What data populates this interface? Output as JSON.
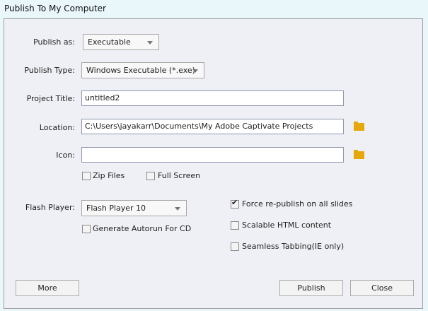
{
  "window": {
    "title": "Publish To My Computer"
  },
  "form": {
    "publish_as_label": "Publish as:",
    "publish_as_value": "Executable",
    "publish_type_label": "Publish Type:",
    "publish_type_value": "Windows Executable (*.exe)",
    "project_title_label": "Project Title:",
    "project_title_value": "untitled2",
    "location_label": "Location:",
    "location_value": "C:\\Users\\jayakarr\\Documents\\My Adobe Captivate Projects",
    "icon_label": "Icon:",
    "icon_value": "",
    "zip_files": {
      "label": "Zip Files",
      "checked": false
    },
    "full_screen": {
      "label": "Full Screen",
      "checked": false
    },
    "flash_player_label": "Flash Player:",
    "flash_player_value": "Flash Player 10",
    "autorun": {
      "label": "Generate Autorun For CD",
      "checked": false
    },
    "force_republish": {
      "label": "Force re-publish on all slides",
      "checked": true
    },
    "scalable_html": {
      "label": "Scalable HTML content",
      "checked": false
    },
    "seamless_tabbing": {
      "label": "Seamless Tabbing(IE only)",
      "checked": false
    }
  },
  "buttons": {
    "more": "More",
    "publish": "Publish",
    "close": "Close"
  }
}
